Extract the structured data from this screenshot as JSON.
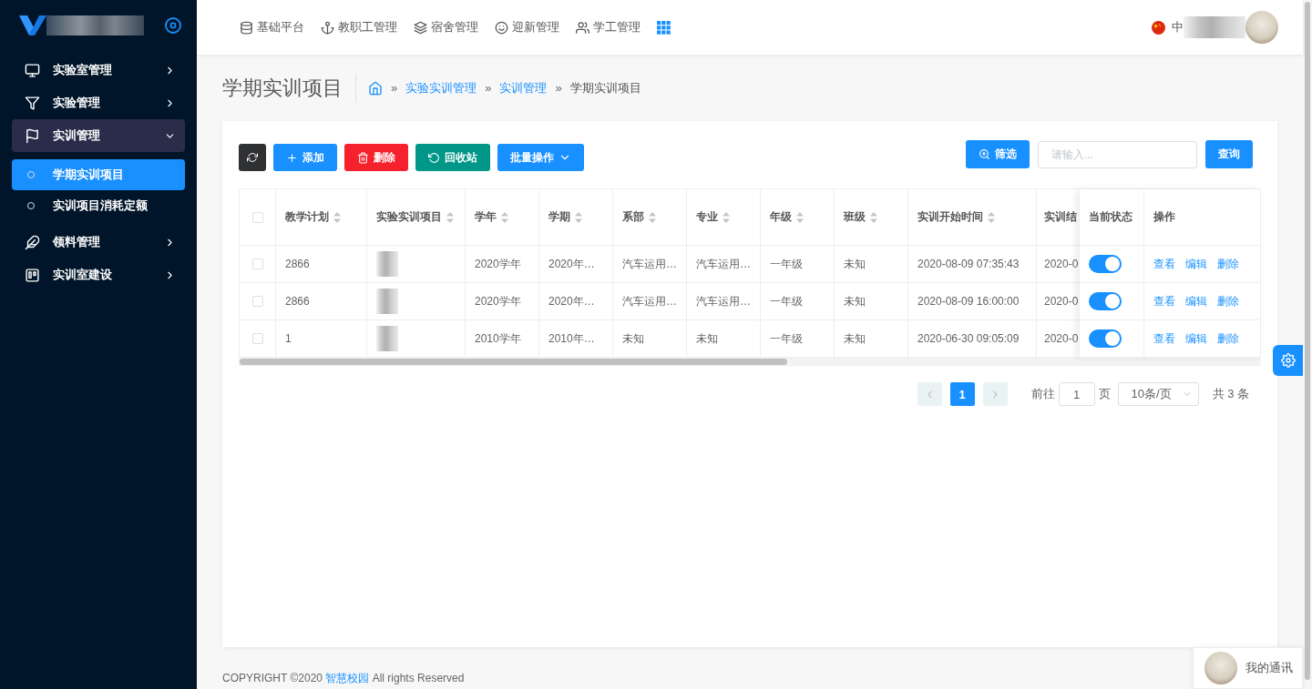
{
  "sidebar": {
    "items": [
      {
        "label": "实验室管理",
        "expanded": false
      },
      {
        "label": "实验管理",
        "expanded": false
      },
      {
        "label": "实训管理",
        "expanded": true,
        "children": [
          {
            "label": "学期实训项目",
            "selected": true
          },
          {
            "label": "实训项目消耗定额",
            "selected": false
          }
        ]
      },
      {
        "label": "领料管理",
        "expanded": false
      },
      {
        "label": "实训室建设",
        "expanded": false
      }
    ]
  },
  "top_nav": {
    "items": [
      {
        "label": "基础平台"
      },
      {
        "label": "教职工管理"
      },
      {
        "label": "宿舍管理"
      },
      {
        "label": "迎新管理"
      },
      {
        "label": "学工管理"
      }
    ],
    "language": "中"
  },
  "page_header": {
    "title": "学期实训项目",
    "separator": "»",
    "breadcrumb": [
      {
        "label": "实验实训管理",
        "link": true
      },
      {
        "label": "实训管理",
        "link": true
      },
      {
        "label": "学期实训项目",
        "link": false
      }
    ]
  },
  "toolbar": {
    "buttons": [
      {
        "kind": "refresh"
      },
      {
        "kind": "add",
        "label": "添加"
      },
      {
        "kind": "delete",
        "label": "删除"
      },
      {
        "kind": "recycle",
        "label": "回收站"
      },
      {
        "kind": "batch",
        "label": "批量操作"
      }
    ],
    "filter_button": "筛选",
    "search": {
      "placeholder": "请输入..."
    },
    "query_button": "查询"
  },
  "table": {
    "all_checked": false,
    "columns": [
      {
        "label": "教学计划",
        "kind": "text",
        "sortable": true
      },
      {
        "label": "实验实训项目",
        "kind": "text",
        "sortable": true
      },
      {
        "label": "学年",
        "kind": "text",
        "sortable": true
      },
      {
        "label": "学期",
        "kind": "text",
        "sortable": true
      },
      {
        "label": "系部",
        "kind": "text",
        "sortable": true
      },
      {
        "label": "专业",
        "kind": "text",
        "sortable": true
      },
      {
        "label": "年级",
        "kind": "text",
        "sortable": true
      },
      {
        "label": "班级",
        "kind": "text",
        "sortable": true
      },
      {
        "label": "实训开始时间",
        "kind": "text",
        "sortable": true
      },
      {
        "label": "实训结",
        "kind": "text",
        "sortable": false
      },
      {
        "label": "当前状态",
        "kind": "status",
        "sortable": false
      },
      {
        "label": "操作",
        "kind": "actions",
        "sortable": false
      }
    ],
    "rows": [
      {
        "checked": false,
        "cells": [
          {
            "text": "2866"
          },
          {
            "redacted": true
          },
          {
            "text": "2020学年"
          },
          {
            "text": "2020年…"
          },
          {
            "text": "汽车运用…"
          },
          {
            "text": "汽车运用…"
          },
          {
            "text": "一年级"
          },
          {
            "text": "未知"
          },
          {
            "text": "2020-08-09 07:35:43"
          },
          {
            "text": "2020-0"
          }
        ],
        "status_on": true,
        "actions": [
          "查看",
          "编辑",
          "删除"
        ]
      },
      {
        "checked": false,
        "cells": [
          {
            "text": "2866"
          },
          {
            "redacted": true
          },
          {
            "text": "2020学年"
          },
          {
            "text": "2020年…"
          },
          {
            "text": "汽车运用…"
          },
          {
            "text": "汽车运用…"
          },
          {
            "text": "一年级"
          },
          {
            "text": "未知"
          },
          {
            "text": "2020-08-09 16:00:00"
          },
          {
            "text": "2020-0"
          }
        ],
        "status_on": true,
        "actions": [
          "查看",
          "编辑",
          "删除"
        ]
      },
      {
        "checked": false,
        "cells": [
          {
            "text": "1"
          },
          {
            "redacted": true
          },
          {
            "text": "2010学年"
          },
          {
            "text": "2010年…"
          },
          {
            "text": "未知"
          },
          {
            "text": "未知"
          },
          {
            "text": "一年级"
          },
          {
            "text": "未知"
          },
          {
            "text": "2020-06-30 09:05:09"
          },
          {
            "text": "2020-0"
          }
        ],
        "status_on": true,
        "actions": [
          "查看",
          "编辑",
          "删除"
        ]
      }
    ]
  },
  "pagination": {
    "prev_disabled": true,
    "pages": [
      {
        "label": "1",
        "selected": true
      }
    ],
    "next_disabled": true,
    "goto_label": "前往",
    "goto_value": "1",
    "page_unit": "页",
    "page_size": "10条/页",
    "total": "共 3 条"
  },
  "chat_widget": {
    "label": "我的通讯"
  },
  "footer": {
    "text": "COPYRIGHT ©2020",
    "link": "智慧校园",
    "suffix": "All rights Reserved"
  }
}
